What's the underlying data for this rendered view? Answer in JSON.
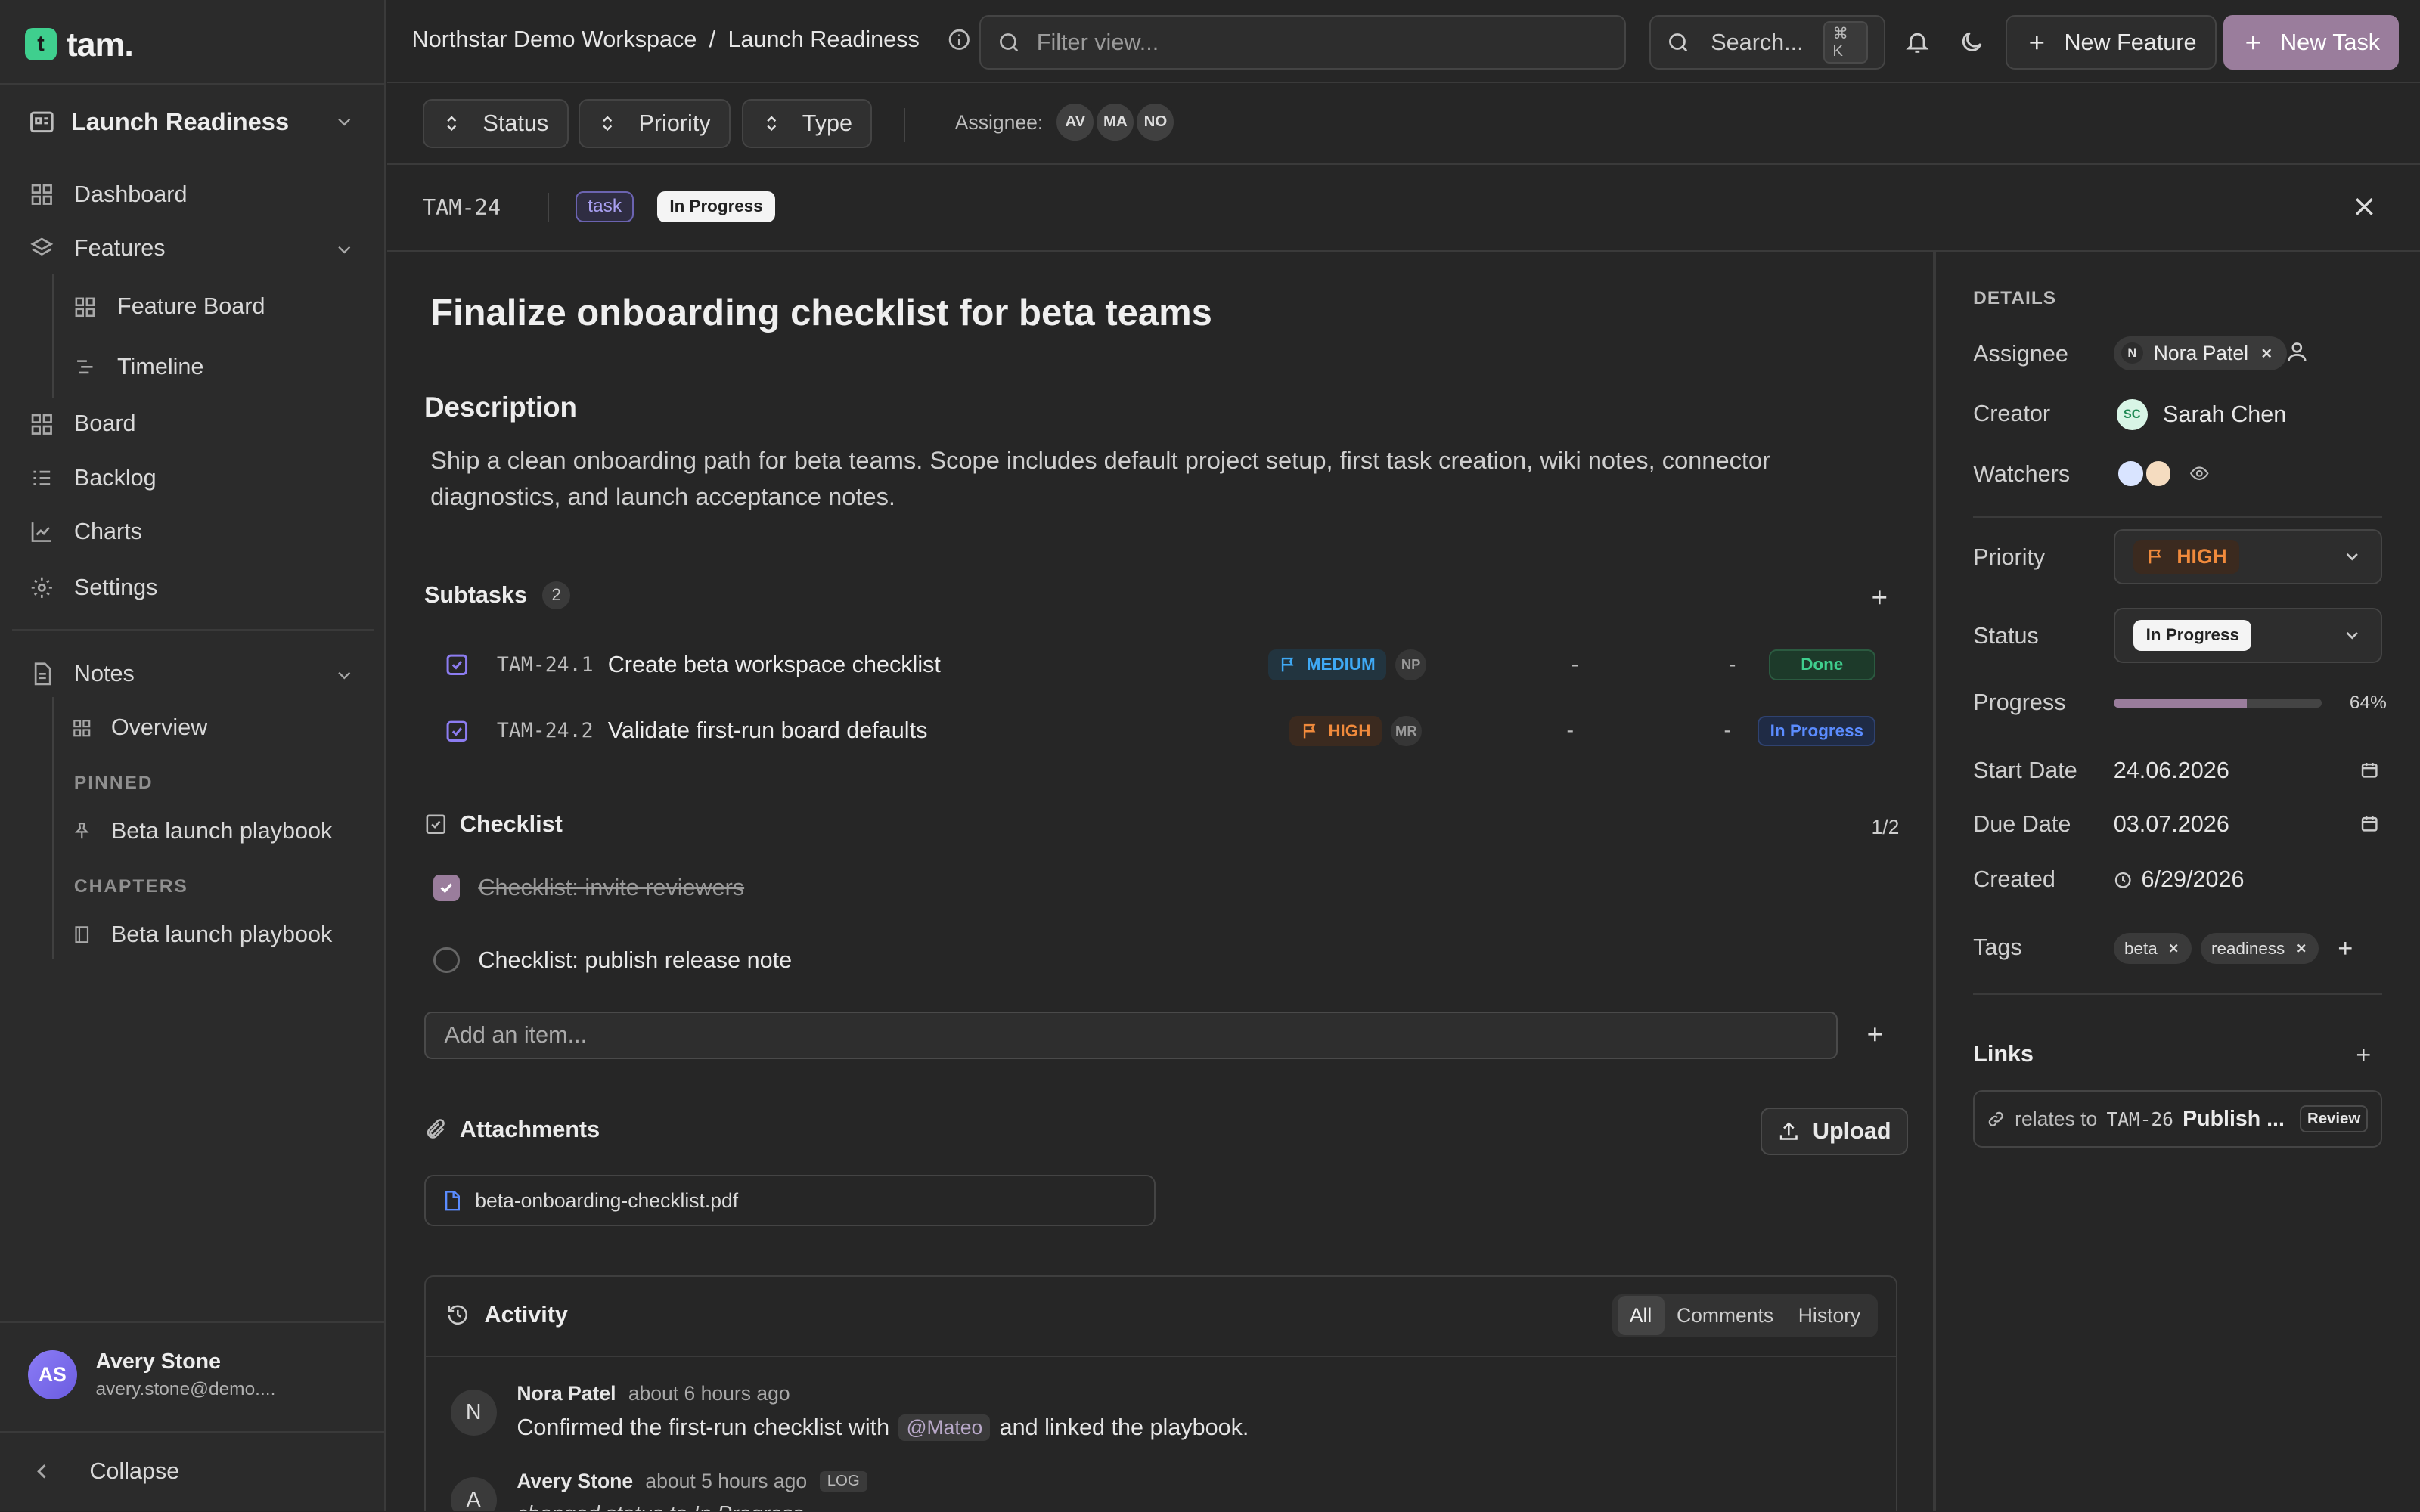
{
  "app": {
    "logo_letter": "t",
    "name": "tam."
  },
  "sidebar": {
    "project": "Launch Readiness",
    "nav": {
      "dashboard": "Dashboard",
      "features": "Features",
      "feature_board": "Feature Board",
      "timeline": "Timeline",
      "board": "Board",
      "backlog": "Backlog",
      "charts": "Charts",
      "settings": "Settings",
      "notes": "Notes",
      "overview": "Overview"
    },
    "pinned_title": "PINNED",
    "pinned_item": "Beta launch playbook",
    "chapters_title": "CHAPTERS",
    "chapter_item": "Beta launch playbook",
    "user": {
      "initials": "AS",
      "name": "Avery Stone",
      "email": "avery.stone@demo...."
    },
    "collapse": "Collapse"
  },
  "topbar": {
    "workspace": "Northstar Demo Workspace",
    "separator": "/",
    "page": "Launch Readiness",
    "filter_placeholder": "Filter view...",
    "search": "Search...",
    "shortcut": "⌘ K",
    "new_feature": "New Feature",
    "new_task": "New Task"
  },
  "filters": {
    "status": "Status",
    "priority": "Priority",
    "type": "Type",
    "assignee_label": "Assignee:",
    "assignees": [
      "AV",
      "MA",
      "NO"
    ]
  },
  "task": {
    "id": "TAM-24",
    "type": "task",
    "status": "In Progress",
    "title": "Finalize onboarding checklist for beta teams",
    "description_title": "Description",
    "description": "Ship a clean onboarding path for beta teams. Scope includes default project setup, first task creation, wiki notes, connector diagnostics, and launch acceptance notes.",
    "subtasks_title": "Subtasks",
    "subtasks_count": "2",
    "subtasks": [
      {
        "id": "TAM-24.1",
        "title": "Create beta workspace checklist",
        "priority": "MEDIUM",
        "assignee": "NP",
        "start": "-",
        "due": "-",
        "status": "Done"
      },
      {
        "id": "TAM-24.2",
        "title": "Validate first-run board defaults",
        "priority": "HIGH",
        "assignee": "MR",
        "start": "-",
        "due": "-",
        "status": "In Progress"
      }
    ],
    "checklist_title": "Checklist",
    "checklist_progress": "1/2",
    "checklist": [
      {
        "label": "Checklist: invite reviewers",
        "done": true
      },
      {
        "label": "Checklist: publish release note",
        "done": false
      }
    ],
    "add_item_placeholder": "Add an item...",
    "attachments_title": "Attachments",
    "upload": "Upload",
    "attachment": "beta-onboarding-checklist.pdf",
    "activity_title": "Activity",
    "activity_tabs": [
      "All",
      "Comments",
      "History"
    ],
    "activity": [
      {
        "initial": "N",
        "author": "Nora Patel",
        "time": "about 6 hours ago",
        "text_before": "Confirmed the first-run checklist with",
        "mention": "@Mateo",
        "text_after": "and linked the playbook."
      },
      {
        "initial": "A",
        "author": "Avery Stone",
        "time": "about 5 hours ago",
        "badge": "LOG",
        "text": "changed status to In Progress"
      }
    ]
  },
  "details": {
    "title": "DETAILS",
    "assignee_label": "Assignee",
    "assignee_initial": "N",
    "assignee": "Nora Patel",
    "creator_label": "Creator",
    "creator_initials": "SC",
    "creator": "Sarah Chen",
    "watchers_label": "Watchers",
    "priority_label": "Priority",
    "priority": "HIGH",
    "status_label": "Status",
    "status": "In Progress",
    "progress_label": "Progress",
    "progress": 64,
    "progress_text": "64%",
    "start_label": "Start Date",
    "start": "24.06.2026",
    "due_label": "Due Date",
    "due": "03.07.2026",
    "created_label": "Created",
    "created": "6/29/2026",
    "tags_label": "Tags",
    "tags": [
      "beta",
      "readiness"
    ],
    "links_title": "Links",
    "link": {
      "relation": "relates to",
      "id": "TAM-26",
      "title": "Publish ...",
      "status": "Review"
    }
  },
  "colors": {
    "accent": "#9a7d9c",
    "high": "#f08a3c",
    "medium": "#3fa9f5",
    "done": "#3fcf8e",
    "link_blue": "#5b8cff"
  }
}
